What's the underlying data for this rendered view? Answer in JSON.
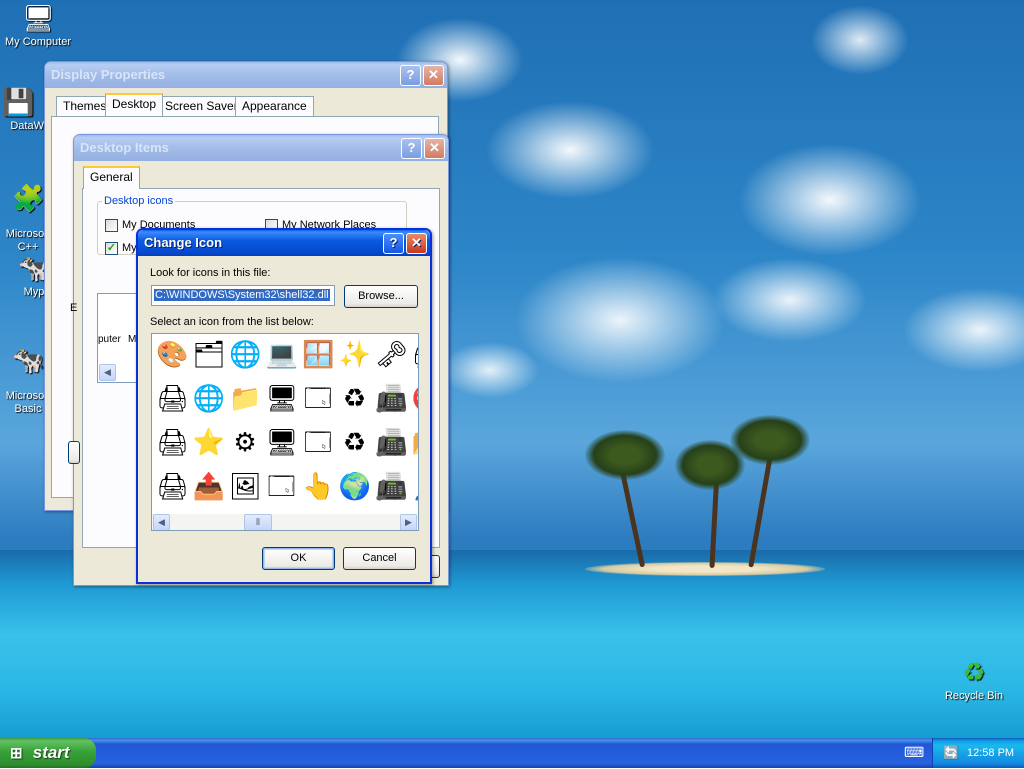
{
  "desktop": {
    "icons": [
      {
        "label": "My Computer",
        "glyph": "🖥"
      },
      {
        "label": "DataWa",
        "glyph": "💾"
      },
      {
        "label": "Microsoft\nC++",
        "glyph": "🧩"
      },
      {
        "label": "Myp",
        "glyph": "🐄"
      },
      {
        "label": "Microsoft\nBasic",
        "glyph": "🐄"
      },
      {
        "label": "Recycle Bin",
        "glyph": "♻"
      }
    ]
  },
  "display_properties": {
    "title": "Display Properties",
    "tabs": [
      "Themes",
      "Desktop",
      "Screen Saver",
      "Appearance"
    ],
    "active_tab": "Desktop"
  },
  "desktop_items": {
    "title": "Desktop Items",
    "tab": "General",
    "group_label": "Desktop icons",
    "checkboxes": [
      {
        "label": "My Documents",
        "checked": false
      },
      {
        "label": "My Network Places",
        "checked": false
      },
      {
        "label": "My",
        "checked": true
      }
    ],
    "partial_labels": {
      "e_label": "E",
      "list_item_1": "puter",
      "list_item_2": "M"
    }
  },
  "change_icon": {
    "title": "Change Icon",
    "look_label": "Look for icons in this file:",
    "file_path": "C:\\WINDOWS\\System32\\shell32.dll",
    "browse_label": "Browse...",
    "select_label": "Select an icon from the list below:",
    "ok_label": "OK",
    "cancel_label": "Cancel",
    "icons": [
      [
        "programs-icon",
        "network-tree-icon",
        "globe-icon",
        "computer-network-icon",
        "window-icon",
        "cursor-sparkle-icon",
        "keys-icon",
        "printer-partial-icon"
      ],
      [
        "printer-check-icon",
        "network-share-icon",
        "folder-network-icon",
        "monitor-icon",
        "window-list-icon",
        "recycle-icon",
        "fax-icon",
        "no-entry-icon"
      ],
      [
        "printer-check2-icon",
        "star-icon",
        "window-gear-icon",
        "monitor2-icon",
        "window-stack-icon",
        "recycle-full-icon",
        "fax-check-icon",
        "folder-partial-icon"
      ],
      [
        "printer-network-icon",
        "folder-arrow-icon",
        "picture-frame-icon",
        "window-grid-icon",
        "hand-pointer-icon",
        "globe-network-icon",
        "fax-network-icon",
        "user-partial-icon"
      ]
    ],
    "glyphs": [
      [
        "🎨",
        "🗂",
        "🌐",
        "💻",
        "🪟",
        "✨",
        "🗝",
        "🖨"
      ],
      [
        "🖨",
        "🌐",
        "📁",
        "🖥",
        "🗔",
        "♻",
        "📠",
        "⛔"
      ],
      [
        "🖨",
        "⭐",
        "⚙",
        "🖥",
        "🗔",
        "♻",
        "📠",
        "📂"
      ],
      [
        "🖨",
        "📤",
        "🖼",
        "🗔",
        "👆",
        "🌍",
        "📠",
        "👤"
      ]
    ]
  },
  "taskbar": {
    "start_label": "start",
    "time": "12:58 PM"
  },
  "colors": {
    "xp_blue": "#0a5be0",
    "start_green": "#37a337",
    "window_face": "#ece9d8"
  }
}
